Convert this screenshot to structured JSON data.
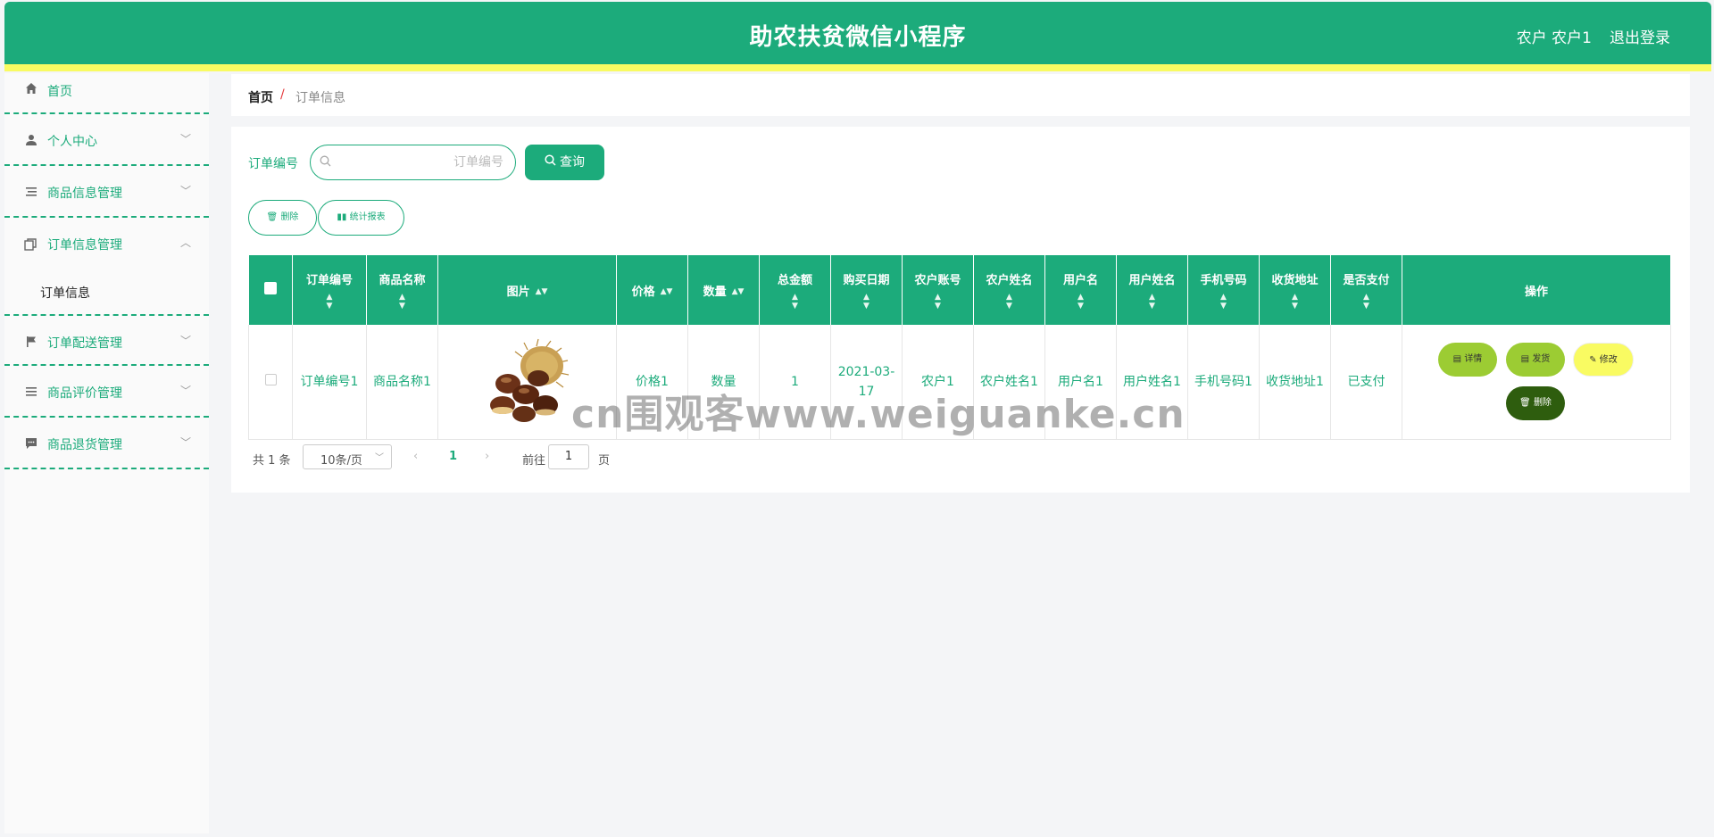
{
  "header": {
    "title": "助农扶贫微信小程序",
    "user": "农户 农户1",
    "logout": "退出登录"
  },
  "sidebar": {
    "items": [
      {
        "label": "首页",
        "icon": "home-icon"
      },
      {
        "label": "个人中心",
        "icon": "user-icon"
      },
      {
        "label": "商品信息管理",
        "icon": "list-icon"
      },
      {
        "label": "订单信息管理",
        "icon": "copy-icon",
        "submenu": [
          "订单信息"
        ]
      },
      {
        "label": "订单配送管理",
        "icon": "flag-icon"
      },
      {
        "label": "商品评价管理",
        "icon": "menu-icon"
      },
      {
        "label": "商品退货管理",
        "icon": "chat-icon"
      }
    ]
  },
  "breadcrumb": {
    "home": "首页",
    "separator": "/",
    "current": "订单信息"
  },
  "search": {
    "label": "订单编号",
    "placeholder": "订单编号",
    "button": "查询"
  },
  "toolbar": {
    "delete": "删除",
    "stats": "统计报表"
  },
  "table": {
    "columns": [
      "订单编号",
      "商品名称",
      "图片",
      "价格",
      "数量",
      "总金额",
      "购买日期",
      "农户账号",
      "农户姓名",
      "用户名",
      "用户姓名",
      "手机号码",
      "收货地址",
      "是否支付",
      "操作"
    ],
    "rows": [
      {
        "order_no": "订单编号1",
        "product": "商品名称1",
        "image": "chestnut",
        "price": "价格1",
        "qty": "数量",
        "total": "1",
        "date": "2021-03-17",
        "farmer_account": "农户1",
        "farmer_name": "农户姓名1",
        "username": "用户名1",
        "user_name": "用户姓名1",
        "phone": "手机号码1",
        "address": "收货地址1",
        "paid": "已支付"
      }
    ],
    "actions": {
      "detail": "详情",
      "ship": "发货",
      "edit": "修改",
      "delete": "删除"
    }
  },
  "pagination": {
    "total": "共 1 条",
    "page_size": "10条/页",
    "current_page": "1",
    "goto_label": "前往",
    "goto_value": "1",
    "page_unit": "页"
  },
  "watermark": "cn围观客www.weiguanke.cn",
  "colors": {
    "primary": "#1cab7b",
    "stripe": "#f9fb62",
    "ship": "#9ccc33",
    "delete_dark": "#2e5d0e"
  }
}
